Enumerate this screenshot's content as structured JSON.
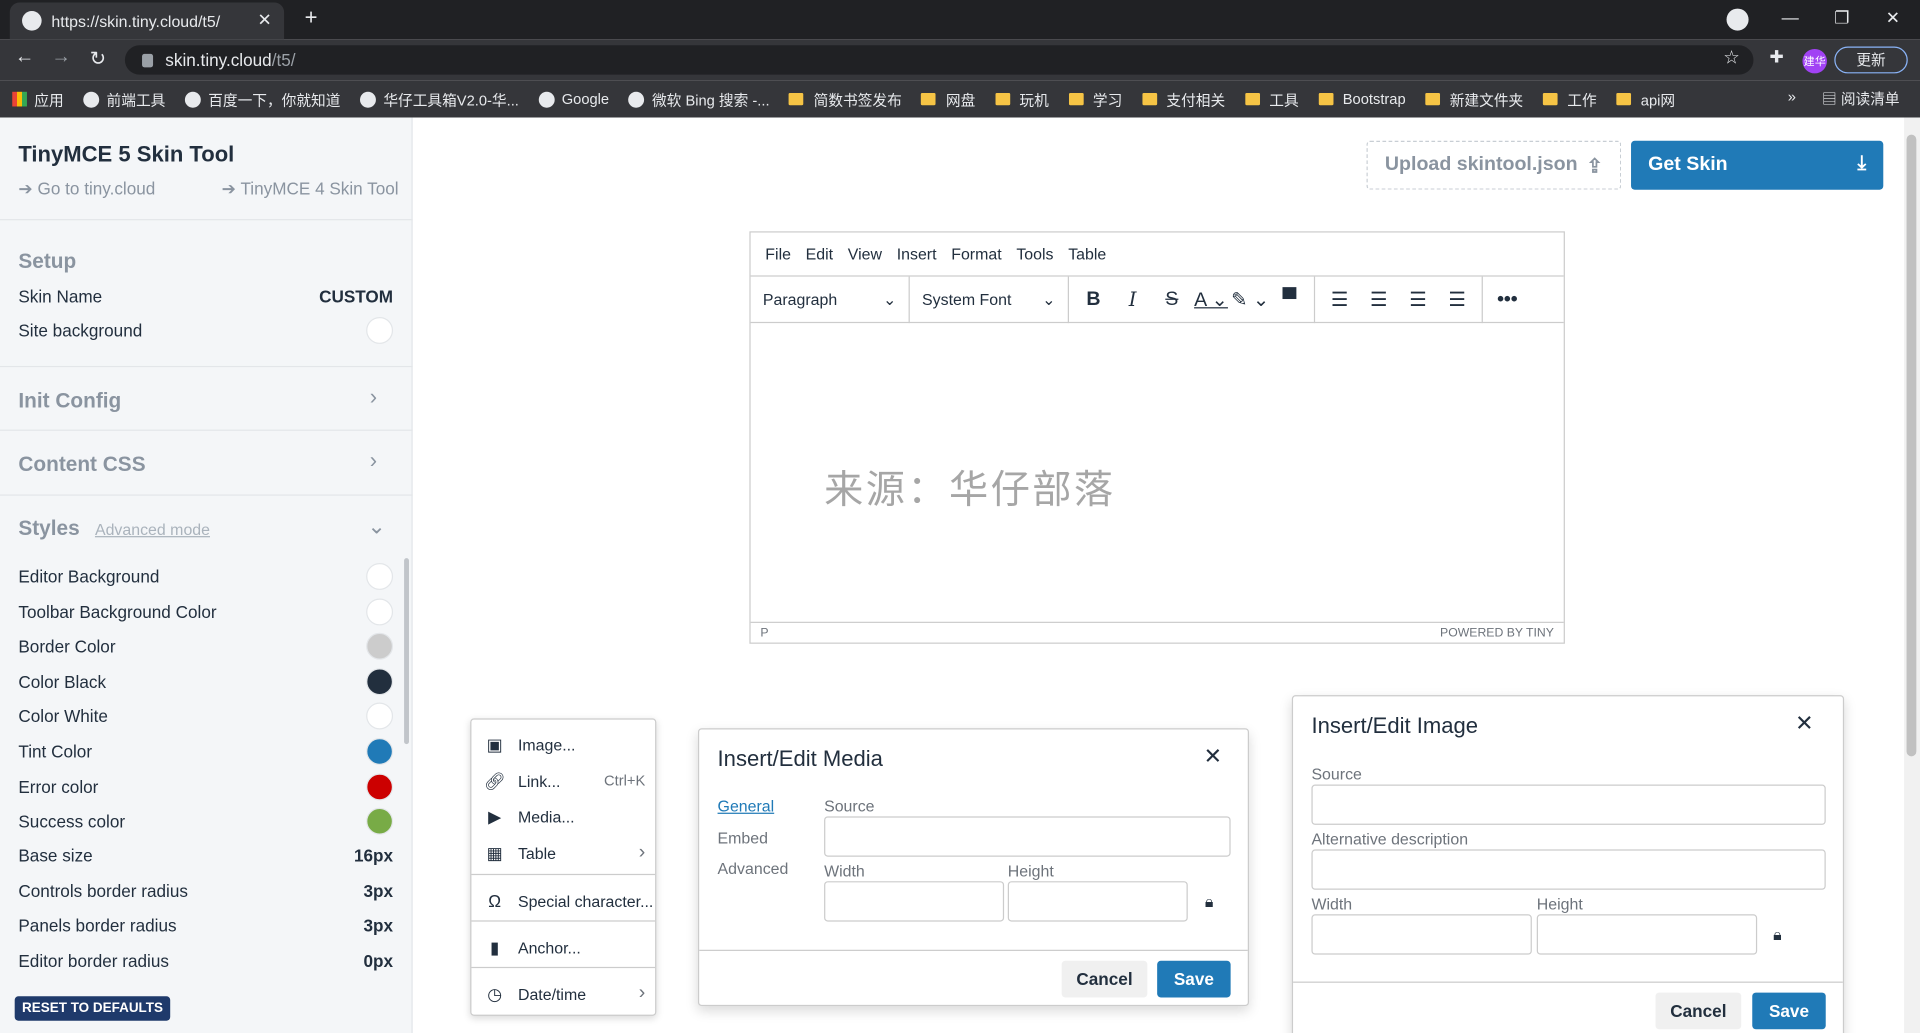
{
  "browser": {
    "tab_title": "https://skin.tiny.cloud/t5/",
    "url_domain": "skin.tiny.cloud",
    "url_path": "/t5/",
    "update_label": "更新",
    "avatar_label": "建华",
    "bookmarks": [
      "应用",
      "前端工具",
      "百度一下，你就知道",
      "华仔工具箱V2.0-华...",
      "Google",
      "微软 Bing 搜索 -...",
      "简数书签发布",
      "网盘",
      "玩机",
      "学习",
      "支付相关",
      "工具",
      "Bootstrap",
      "新建文件夹",
      "工作",
      "api网"
    ],
    "bookmark_more": "»",
    "reading_list": "阅读清单"
  },
  "sidebar": {
    "title": "TinyMCE 5 Skin Tool",
    "link1": "Go to tiny.cloud",
    "link2": "TinyMCE 4 Skin Tool",
    "setup_heading": "Setup",
    "skin_name_label": "Skin Name",
    "skin_name_value": "CUSTOM",
    "site_bg_label": "Site background",
    "init_config": "Init Config",
    "content_css": "Content CSS",
    "styles": "Styles",
    "advanced_mode": "Advanced mode",
    "style_rows": [
      {
        "label": "Editor Background",
        "color": "#ffffff"
      },
      {
        "label": "Toolbar Background Color",
        "color": "#ffffff"
      },
      {
        "label": "Border Color",
        "color": "#cccccc"
      },
      {
        "label": "Color Black",
        "color": "#222f3e"
      },
      {
        "label": "Color White",
        "color": "#ffffff"
      },
      {
        "label": "Tint Color",
        "color": "#207ab7"
      },
      {
        "label": "Error color",
        "color": "#cc0000"
      },
      {
        "label": "Success color",
        "color": "#78ab46"
      }
    ],
    "value_rows": [
      {
        "label": "Base size",
        "value": "16px"
      },
      {
        "label": "Controls border radius",
        "value": "3px"
      },
      {
        "label": "Panels border radius",
        "value": "3px"
      },
      {
        "label": "Editor border radius",
        "value": "0px"
      }
    ],
    "reset": "RESET TO DEFAULTS"
  },
  "actions": {
    "upload": "Upload skintool.json",
    "get_skin": "Get Skin"
  },
  "editor": {
    "menus": [
      "File",
      "Edit",
      "View",
      "Insert",
      "Format",
      "Tools",
      "Table"
    ],
    "block_format": "Paragraph",
    "font": "System Font",
    "content": "来源：华仔部落",
    "path": "P",
    "powered": "POWERED BY TINY"
  },
  "insert_menu": {
    "items": [
      {
        "label": "Image...",
        "icon": "image-icon"
      },
      {
        "label": "Link...",
        "shortcut": "Ctrl+K",
        "icon": "link-icon"
      },
      {
        "label": "Media...",
        "icon": "media-icon"
      },
      {
        "label": "Table",
        "icon": "table-icon"
      },
      {
        "label": "Special character...",
        "icon": "omega-icon"
      },
      {
        "label": "Anchor...",
        "icon": "bookmark-icon"
      },
      {
        "label": "Date/time",
        "icon": "clock-icon"
      }
    ]
  },
  "media_dialog": {
    "title": "Insert/Edit Media",
    "tabs": [
      "General",
      "Embed",
      "Advanced"
    ],
    "source": "Source",
    "width": "Width",
    "height": "Height",
    "cancel": "Cancel",
    "save": "Save"
  },
  "image_dialog": {
    "title": "Insert/Edit Image",
    "source": "Source",
    "alt": "Alternative description",
    "width": "Width",
    "height": "Height",
    "cancel": "Cancel",
    "save": "Save"
  }
}
